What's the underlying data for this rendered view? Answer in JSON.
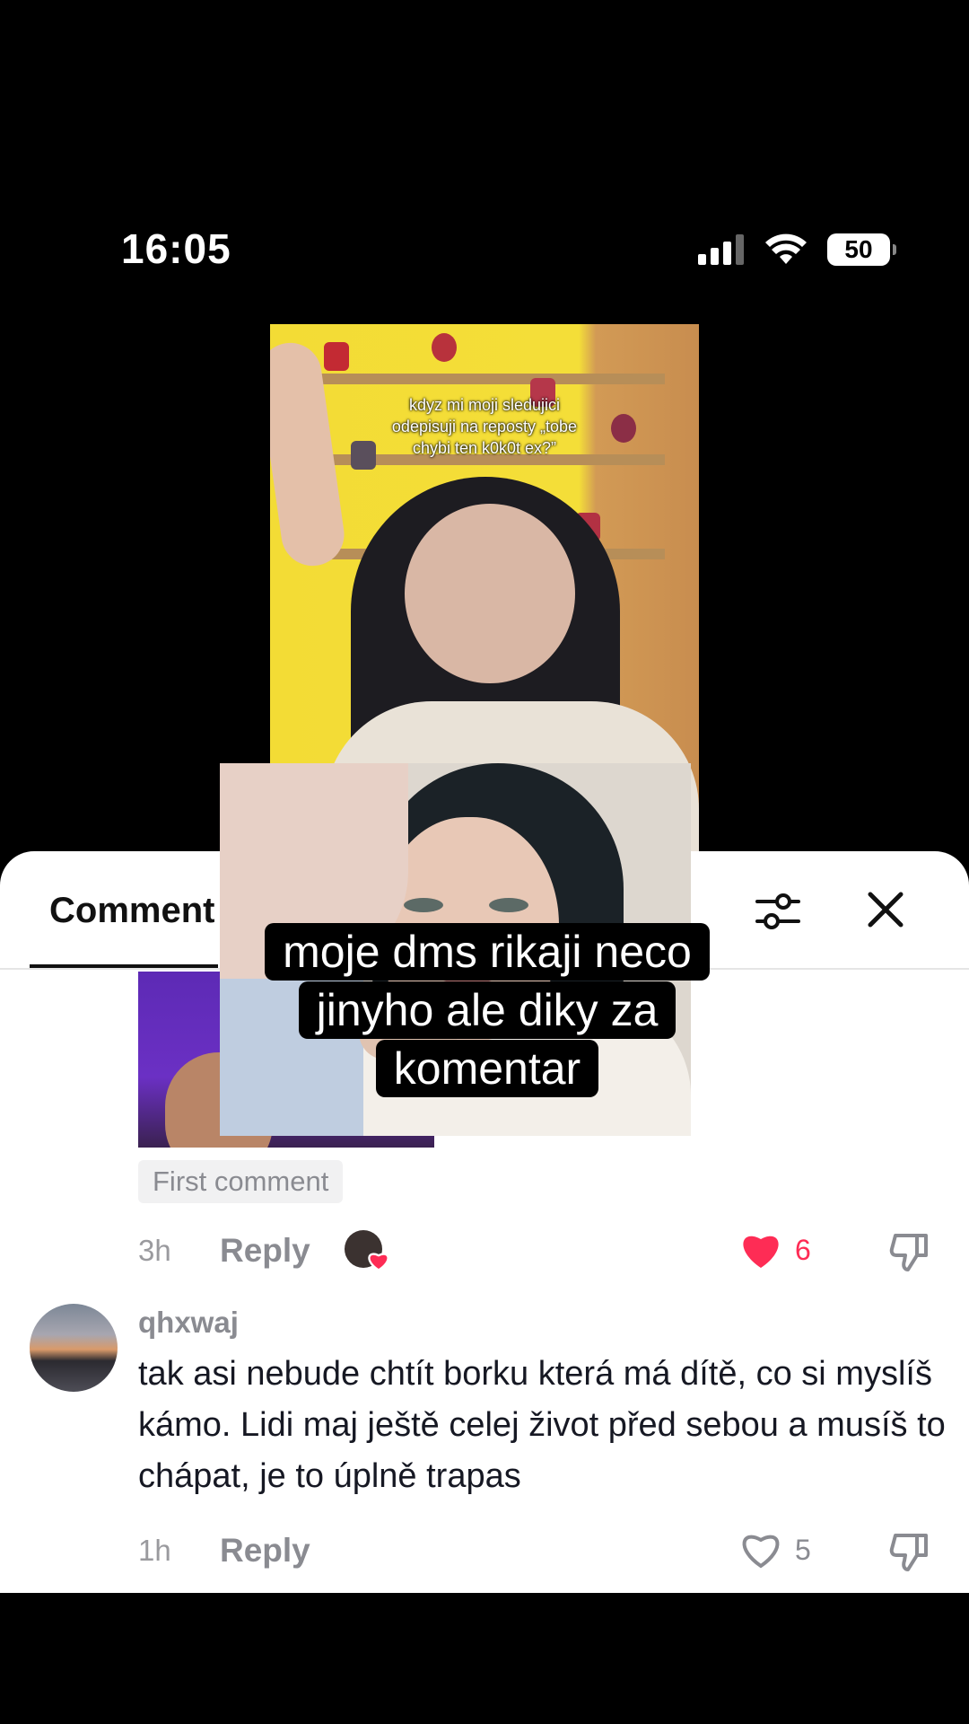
{
  "status_bar": {
    "time": "16:05",
    "battery": "50"
  },
  "video": {
    "caption_lines": [
      "kdyz mi moji sledujici",
      "odepisuji na reposty „tobe",
      "chybi ten k0k0t ex?”"
    ]
  },
  "overlay_text": {
    "lines": [
      "moje dms rikaji neco",
      "jinyho ale diky za",
      "komentar"
    ]
  },
  "panel": {
    "tab_label": "Comment",
    "comments": [
      {
        "tag": "First comment",
        "time": "3h",
        "reply": "Reply",
        "likes": "6",
        "liked": true
      },
      {
        "username": "qhxwaj",
        "text": "tak asi nebude chtít borku která má dítě, co si myslíš kámo. Lidi maj ještě celej život před sebou a musíš to chápat, je to úplně trapas",
        "time": "1h",
        "reply": "Reply",
        "likes": "5",
        "liked": false
      }
    ]
  },
  "colors": {
    "like_active": "#fe2c55",
    "muted_text": "#8a8b91"
  }
}
